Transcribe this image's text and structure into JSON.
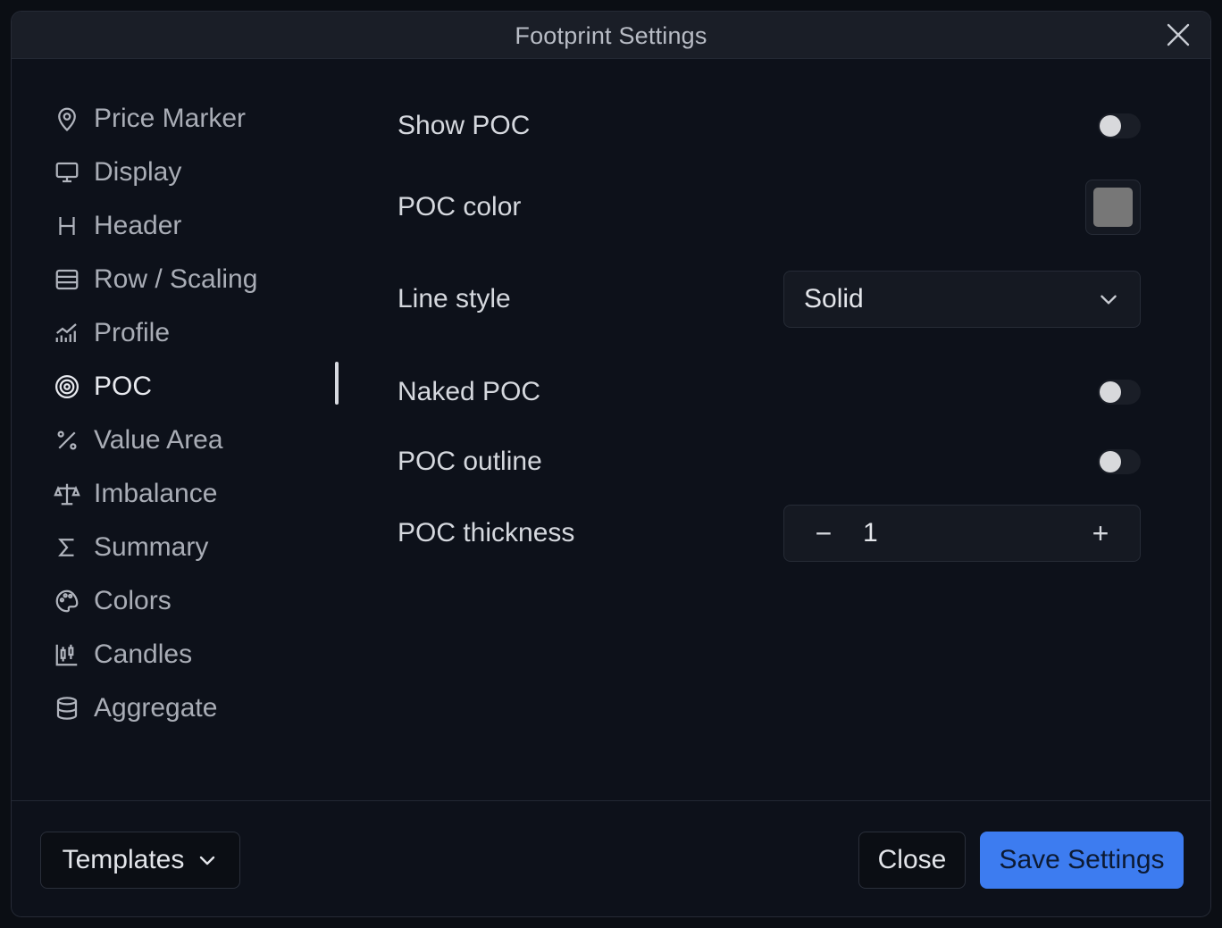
{
  "dialog": {
    "title": "Footprint Settings"
  },
  "sidebar": {
    "items": [
      {
        "label": "Price Marker",
        "icon": "map-pin-icon"
      },
      {
        "label": "Display",
        "icon": "monitor-icon"
      },
      {
        "label": "Header",
        "icon": "heading-icon"
      },
      {
        "label": "Row / Scaling",
        "icon": "rows-icon"
      },
      {
        "label": "Profile",
        "icon": "bar-chart-icon"
      },
      {
        "label": "POC",
        "icon": "target-icon",
        "active": true
      },
      {
        "label": "Value Area",
        "icon": "percent-icon"
      },
      {
        "label": "Imbalance",
        "icon": "scale-icon"
      },
      {
        "label": "Summary",
        "icon": "sigma-icon"
      },
      {
        "label": "Colors",
        "icon": "palette-icon"
      },
      {
        "label": "Candles",
        "icon": "candles-icon"
      },
      {
        "label": "Aggregate",
        "icon": "database-icon"
      }
    ]
  },
  "settings": {
    "show_poc": {
      "label": "Show POC",
      "enabled": false
    },
    "poc_color": {
      "label": "POC color",
      "color": "#777777"
    },
    "line_style": {
      "label": "Line style",
      "value": "Solid"
    },
    "naked_poc": {
      "label": "Naked POC",
      "enabled": false
    },
    "poc_outline": {
      "label": "POC outline",
      "enabled": false
    },
    "poc_thickness": {
      "label": "POC thickness",
      "value": "1",
      "minus": "−",
      "plus": "+"
    }
  },
  "footer": {
    "templates_label": "Templates",
    "close_label": "Close",
    "save_label": "Save Settings"
  },
  "colors": {
    "accent": "#3d7cf0",
    "background": "#0d111a",
    "titlebar": "#1a1e27"
  }
}
